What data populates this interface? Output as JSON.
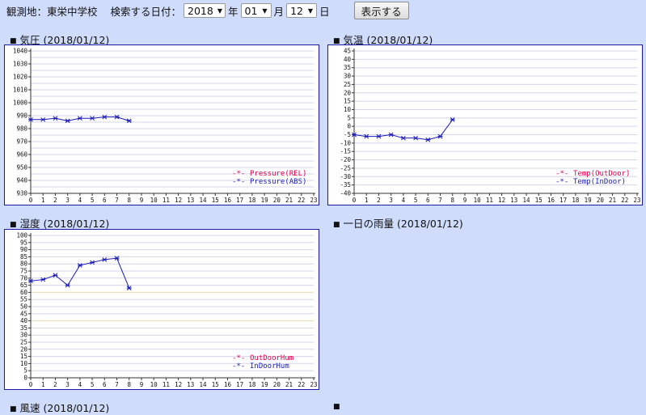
{
  "header": {
    "station_label": "観測地：東栄中学校",
    "search_label": "検索する日付：",
    "year_value": "2018",
    "year_unit": "年",
    "month_value": "01",
    "month_unit": "月",
    "day_value": "12",
    "day_unit": "日",
    "show_button": "表示する"
  },
  "panels": {
    "pressure_title": "気圧 (2018/01/12)",
    "temp_title": "気温 (2018/01/12)",
    "humidity_title": "湿度 (2018/01/12)",
    "rain_title": "一日の雨量 (2018/01/12)",
    "wind_title": "風速 (2018/01/12)",
    "blank_title": ""
  },
  "colors": {
    "series_red": "#e0004a",
    "series_blue": "#1a1ab8",
    "grid": "#d4d4ea",
    "grid_band": "#e2d7ae",
    "border": "#1a1aa8"
  },
  "chart_data": [
    {
      "type": "line",
      "id": "pressure",
      "x": [
        0,
        1,
        2,
        3,
        4,
        5,
        6,
        7,
        8
      ],
      "xlim": [
        0,
        23
      ],
      "ylim": [
        930,
        1040
      ],
      "yticks": [
        930,
        940,
        950,
        960,
        970,
        980,
        990,
        1000,
        1010,
        1020,
        1030,
        1040
      ],
      "grid_step": 5,
      "series": [
        {
          "name": "Pressure(REL)",
          "values": []
        },
        {
          "name": "Pressure(ABS)",
          "values": [
            987,
            987,
            988,
            986,
            988,
            988,
            989,
            989,
            986
          ]
        }
      ]
    },
    {
      "type": "line",
      "id": "temp",
      "x": [
        0,
        1,
        2,
        3,
        4,
        5,
        6,
        7,
        8
      ],
      "xlim": [
        0,
        23
      ],
      "ylim": [
        -40,
        45
      ],
      "yticks": [
        -40,
        -35,
        -30,
        -25,
        -20,
        -15,
        -10,
        -5,
        0,
        5,
        10,
        15,
        20,
        25,
        30,
        35,
        40,
        45
      ],
      "grid_step": 5,
      "series": [
        {
          "name": "Temp(OutDoor)",
          "values": []
        },
        {
          "name": "Temp(InDoor)",
          "values": [
            -5,
            -6,
            -6,
            -5,
            -7,
            -7,
            -8,
            -6,
            4
          ]
        }
      ]
    },
    {
      "type": "line",
      "id": "humidity",
      "x": [
        0,
        1,
        2,
        3,
        4,
        5,
        6,
        7,
        8
      ],
      "xlim": [
        0,
        23
      ],
      "ylim": [
        0,
        100
      ],
      "yticks": [
        0,
        5,
        10,
        15,
        20,
        25,
        30,
        35,
        40,
        45,
        50,
        55,
        60,
        65,
        70,
        75,
        80,
        85,
        90,
        95,
        100
      ],
      "grid_step": 5,
      "bands": [
        60,
        40
      ],
      "series": [
        {
          "name": "OutDoorHum",
          "values": []
        },
        {
          "name": "InDoorHum",
          "values": [
            68,
            69,
            72,
            65,
            79,
            81,
            83,
            84,
            63
          ]
        }
      ]
    }
  ]
}
